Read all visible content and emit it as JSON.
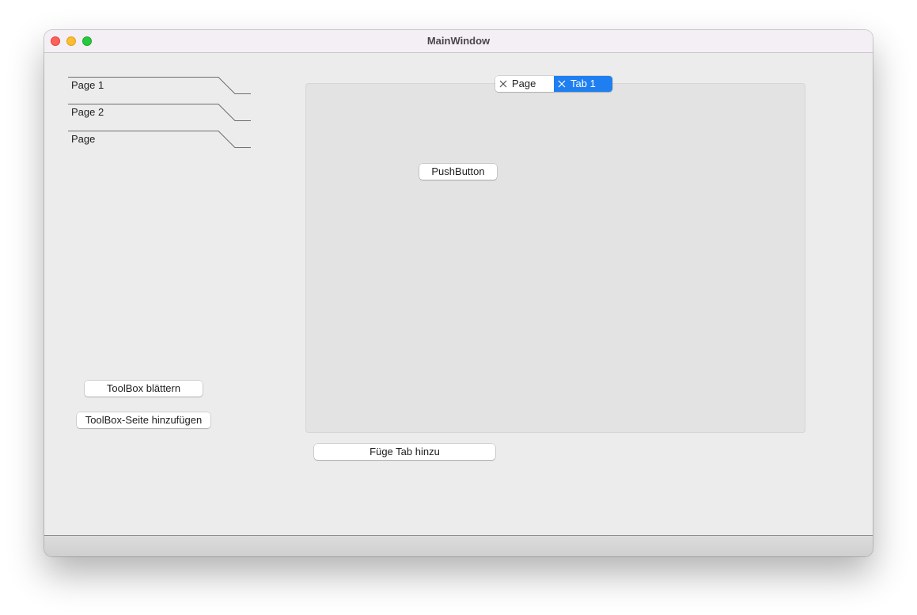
{
  "window": {
    "title": "MainWindow"
  },
  "toolbox": {
    "items": [
      {
        "label": "Page 1"
      },
      {
        "label": "Page 2"
      },
      {
        "label": "Page"
      }
    ],
    "scroll_button": "ToolBox blättern",
    "add_page_button": "ToolBox-Seite hinzufügen"
  },
  "tabs": {
    "items": [
      {
        "label": "Page",
        "selected": false
      },
      {
        "label": "Tab 1",
        "selected": true
      }
    ],
    "content_button": "PushButton",
    "add_tab_button": "Füge Tab hinzu",
    "selected_color": "#1f7ff0"
  }
}
